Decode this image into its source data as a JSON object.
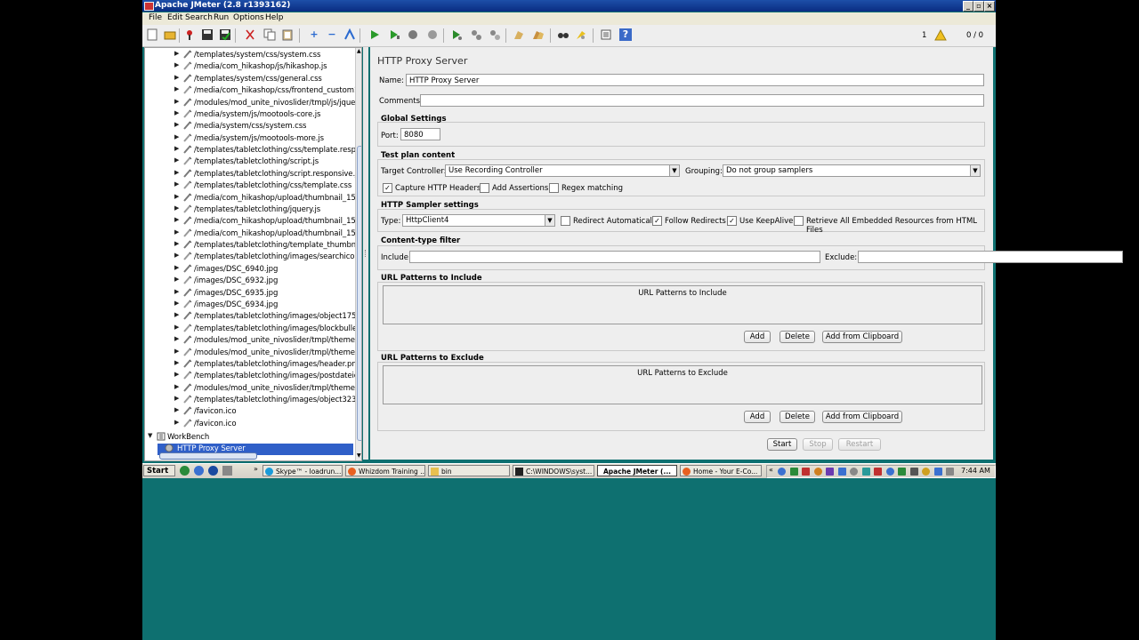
{
  "window": {
    "title": "Apache JMeter (2.8 r1393162)"
  },
  "menu": [
    "File",
    "Edit",
    "Search",
    "Run",
    "Options",
    "Help"
  ],
  "toolbar": {
    "warning_count": "1",
    "thread_counter": "0 / 0"
  },
  "tree": {
    "items": [
      "/templates/system/css/system.css",
      "/media/com_hikashop/js/hikashop.js",
      "/templates/system/css/general.css",
      "/media/com_hikashop/css/frontend_custom1.css",
      "/modules/mod_unite_nivoslider/tmpl/js/jquery.nivo.s",
      "/media/system/js/mootools-core.js",
      "/media/system/css/system.css",
      "/media/system/js/mootools-more.js",
      "/templates/tabletclothing/css/template.responsive.c",
      "/templates/tabletclothing/script.js",
      "/templates/tabletclothing/script.responsive.js",
      "/templates/tabletclothing/css/template.css",
      "/media/com_hikashop/upload/thumbnail_150x150/5(",
      "/templates/tabletclothing/jquery.js",
      "/media/com_hikashop/upload/thumbnail_150x150/w",
      "/media/com_hikashop/upload/thumbnail_150x150/tr",
      "/templates/tabletclothing/template_thumbnail.png",
      "/templates/tabletclothing/images/searchicon.png",
      "/images/DSC_6940.jpg",
      "/images/DSC_6932.jpg",
      "/images/DSC_6935.jpg",
      "/images/DSC_6934.jpg",
      "/templates/tabletclothing/images/object1755072401",
      "/templates/tabletclothing/images/blockbullets.png",
      "/modules/mod_unite_nivoslider/tmpl/themes/default",
      "/modules/mod_unite_nivoslider/tmpl/themes/default",
      "/templates/tabletclothing/images/header.png",
      "/templates/tabletclothing/images/postdateicon.png",
      "/modules/mod_unite_nivoslider/tmpl/themes/default",
      "/templates/tabletclothing/images/object323200548.p",
      "/favicon.ico",
      "/favicon.ico"
    ],
    "workbench": "WorkBench",
    "selected": "HTTP Proxy Server"
  },
  "panel": {
    "title": "HTTP Proxy Server",
    "name_label": "Name:",
    "name_value": "HTTP Proxy Server",
    "comments_label": "Comments:",
    "comments_value": "",
    "global": {
      "header": "Global Settings",
      "port_label": "Port:",
      "port_value": "8080"
    },
    "testplan": {
      "header": "Test plan content",
      "target_label": "Target Controller:",
      "target_value": "Use Recording Controller",
      "grouping_label": "Grouping:",
      "grouping_value": "Do not group samplers",
      "capture_headers": "Capture HTTP Headers",
      "add_assertions": "Add Assertions",
      "regex_matching": "Regex matching"
    },
    "sampler": {
      "header": "HTTP Sampler settings",
      "type_label": "Type:",
      "type_value": "HttpClient4",
      "redirect_auto": "Redirect Automatically",
      "follow_redirects": "Follow Redirects",
      "keepalive": "Use KeepAlive",
      "retrieve_all": "Retrieve All Embedded Resources from HTML Files"
    },
    "content_filter": {
      "header": "Content-type filter",
      "include_label": "Include:",
      "exclude_label": "Exclude:"
    },
    "include_patterns": {
      "header": "URL Patterns to Include",
      "list_title": "URL Patterns to Include"
    },
    "exclude_patterns": {
      "header": "URL Patterns to Exclude",
      "list_title": "URL Patterns to Exclude"
    },
    "buttons": {
      "add": "Add",
      "delete": "Delete",
      "clipboard": "Add from Clipboard",
      "start": "Start",
      "stop": "Stop",
      "restart": "Restart"
    }
  },
  "taskbar": {
    "start": "Start",
    "tasks": [
      "Skype™ - loadrun...",
      "Whizdom Training ...",
      "bin",
      "C:\\WINDOWS\\syst...",
      "Apache JMeter (...",
      "Home - Your E-Co..."
    ],
    "clock": "7:44 AM"
  }
}
